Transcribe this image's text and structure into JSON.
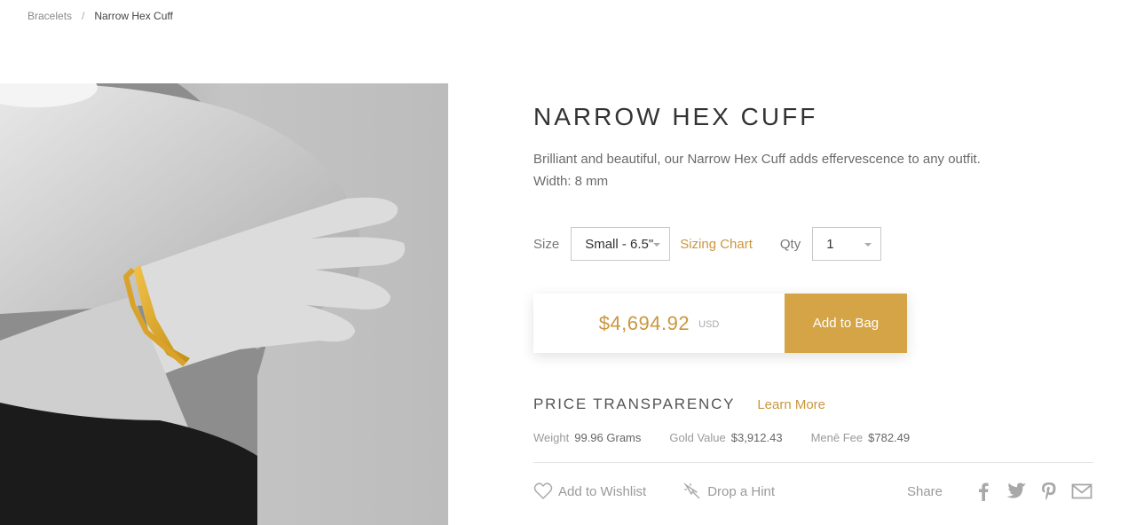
{
  "breadcrumb": {
    "parent": "Bracelets",
    "separator": "/",
    "current": "Narrow Hex Cuff"
  },
  "product": {
    "title": "NARROW HEX CUFF",
    "description": "Brilliant and beautiful, our Narrow Hex Cuff adds effervescence to any outfit.",
    "width": "Width: 8 mm",
    "image_alt": "Woman wearing gold hexagonal cuff bracelet"
  },
  "options": {
    "size_label": "Size",
    "size_value": "Small - 6.5\"",
    "sizing_chart": "Sizing Chart",
    "qty_label": "Qty",
    "qty_value": "1"
  },
  "purchase": {
    "price": "$4,694.92",
    "currency": "USD",
    "add_to_bag": "Add to Bag"
  },
  "transparency": {
    "title": "PRICE TRANSPARENCY",
    "learn_more": "Learn More",
    "weight_label": "Weight",
    "weight_value": "99.96 Grams",
    "gold_label": "Gold Value",
    "gold_value": "$3,912.43",
    "fee_label": "Menē Fee",
    "fee_value": "$782.49"
  },
  "actions": {
    "wishlist": "Add to Wishlist",
    "hint": "Drop a Hint",
    "share": "Share",
    "icons": [
      "heart-icon",
      "hint-icon",
      "facebook-icon",
      "twitter-icon",
      "pinterest-icon",
      "email-icon"
    ]
  },
  "colors": {
    "accent": "#c9973e",
    "button": "#d4a447",
    "text": "#555555"
  }
}
